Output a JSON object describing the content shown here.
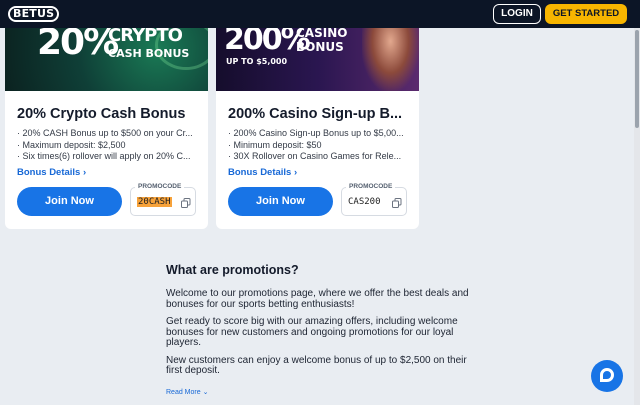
{
  "header": {
    "logo_text": "BETUS",
    "login_label": "LOGIN",
    "get_started_label": "GET STARTED",
    "accent_color": "#f7b500",
    "background_color": "#0c1526"
  },
  "cards": [
    {
      "banner": {
        "big": "20%",
        "line1": "CRYPTO",
        "line2": "CASH BONUS"
      },
      "title": "20% Crypto Cash Bonus",
      "bullets": [
        "20% CASH Bonus up to $500 on your Cr...",
        "Maximum deposit: $2,500",
        "Six times(6) rollover will apply on 20% C..."
      ],
      "details_label": "Bonus Details ›",
      "join_label": "Join Now",
      "promo_label": "PROMOCODE",
      "promo_code": "20CASH"
    },
    {
      "banner": {
        "big": "200%",
        "line1": "CASINO",
        "line2": "BONUS",
        "line3": "UP TO $5,000"
      },
      "title": "200% Casino Sign-up B...",
      "bullets": [
        "200% Casino Sign-up Bonus up to $5,00...",
        "Minimum deposit: $50",
        "30X Rollover on Casino Games for Rele..."
      ],
      "details_label": "Bonus Details ›",
      "join_label": "Join Now",
      "promo_label": "PROMOCODE",
      "promo_code": "CAS200"
    }
  ],
  "content": {
    "heading": "What are promotions?",
    "paragraphs": [
      "Welcome to our promotions page, where we offer the best deals and bonuses for our sports betting enthusiasts!",
      "Get ready to score big with our amazing offers, including welcome bonuses for new customers and ongoing promotions for our loyal players.",
      "New customers can enjoy a welcome bonus of up to $2,500 on their first deposit."
    ],
    "read_more": "Read More ⌄"
  },
  "icons": {
    "copy": "copy-icon",
    "chat": "chat-icon"
  },
  "colors": {
    "primary_button": "#1874e6",
    "link": "#1768d6",
    "page_background": "#e9edf2"
  }
}
